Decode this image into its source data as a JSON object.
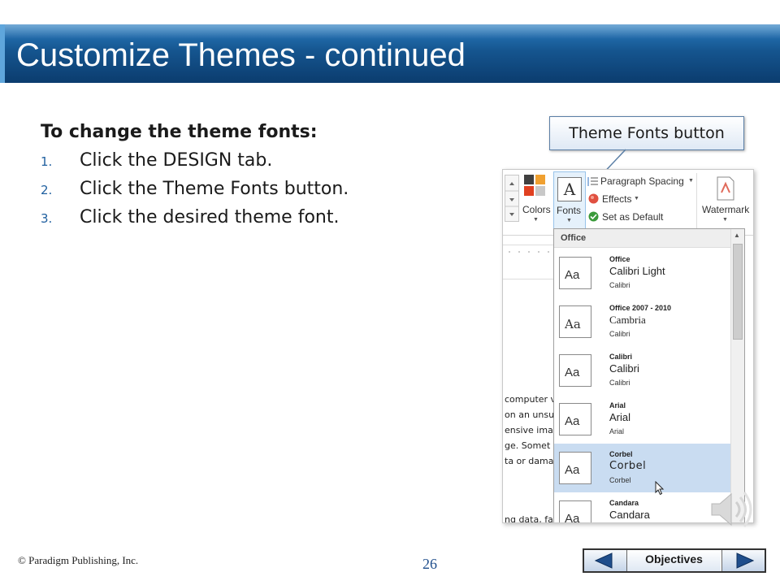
{
  "slide": {
    "title": "Customize Themes - continued",
    "heading": "To change the theme fonts:",
    "steps": [
      {
        "num": "1.",
        "text": "Click the DESIGN tab."
      },
      {
        "num": "2.",
        "text": "Click the Theme Fonts button."
      },
      {
        "num": "3.",
        "text": "Click the desired theme font."
      }
    ],
    "callout": "Theme Fonts button"
  },
  "ribbon": {
    "colors_label": "Colors",
    "fonts_label": "Fonts",
    "fonts_glyph": "A",
    "paragraph_spacing": "Paragraph Spacing",
    "effects": "Effects",
    "set_default": "Set as Default",
    "watermark": "Watermark",
    "colors": {
      "swatch1": "#404040",
      "swatch2": "#f0a030",
      "swatch3": "#e04020",
      "swatch4": "#c8c8c8"
    }
  },
  "document": {
    "lines": [
      "computer v",
      "on an unsu",
      "ensive ima",
      "ge. Somet",
      "ta or dama",
      "ng data, fa"
    ]
  },
  "dropdown": {
    "header": "Office",
    "thumb_text": "Aa",
    "selected_index": 4,
    "items": [
      {
        "name": "Office",
        "heading": "Calibri Light",
        "body": "Calibri"
      },
      {
        "name": "Office 2007 - 2010",
        "heading": "Cambria",
        "body": "Calibri"
      },
      {
        "name": "Calibri",
        "heading": "Calibri",
        "body": "Calibri"
      },
      {
        "name": "Arial",
        "heading": "Arial",
        "body": "Arial"
      },
      {
        "name": "Corbel",
        "heading": "Corbel",
        "body": "Corbel"
      },
      {
        "name": "Candara",
        "heading": "Candara",
        "body": ""
      }
    ]
  },
  "footer": {
    "copyright": "© Paradigm Publishing, Inc.",
    "page_number": "26",
    "nav_label": "Objectives"
  }
}
